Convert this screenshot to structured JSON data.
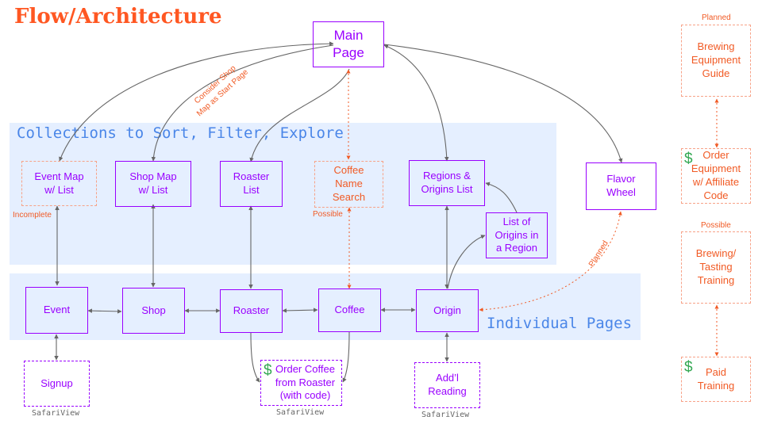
{
  "title": "Flow/Architecture",
  "bands": {
    "collections": "Collections to Sort, Filter, Explore",
    "individual": "Individual Pages"
  },
  "nodes": {
    "main_page": "Main\nPage",
    "event_map": "Event Map\nw/ List",
    "shop_map": "Shop Map\nw/ List",
    "roaster_list": "Roaster\nList",
    "coffee_search": "Coffee\nName\nSearch",
    "regions_list": "Regions &\nOrigins List",
    "origins_in_region": "List of\nOrigins in\na Region",
    "flavor_wheel": "Flavor\nWheel",
    "event": "Event",
    "shop": "Shop",
    "roaster": "Roaster",
    "coffee": "Coffee",
    "origin": "Origin",
    "signup": "Signup",
    "order_coffee": "Order Coffee\nfrom Roaster\n(with code)",
    "addl_reading": "Add’l\nReading",
    "brewing_guide": "Brewing\nEquipment\nGuide",
    "order_equipment": "Order\nEquipment\nw/ Affiliate\nCode",
    "tasting_training": "Brewing/\nTasting\nTraining",
    "paid_training": "Paid\nTraining"
  },
  "dollar_sign": "$",
  "notes": {
    "consider_shop": "Consider Shop",
    "map_start": "Map as Start Page",
    "incomplete": "Incomplete",
    "possible_search": "Possible",
    "planned_flavor": "Planned",
    "planned_guide": "Planned",
    "possible_training": "Possible"
  },
  "safari_view": "SafariView",
  "colors": {
    "title": "#ff5722",
    "node_purple": "#9900ff",
    "note_orange": "#f15a24",
    "band_fill": "#e5efff",
    "band_text": "#4a86e8",
    "dollar_green": "#34a853",
    "connector_gray": "#666666"
  }
}
